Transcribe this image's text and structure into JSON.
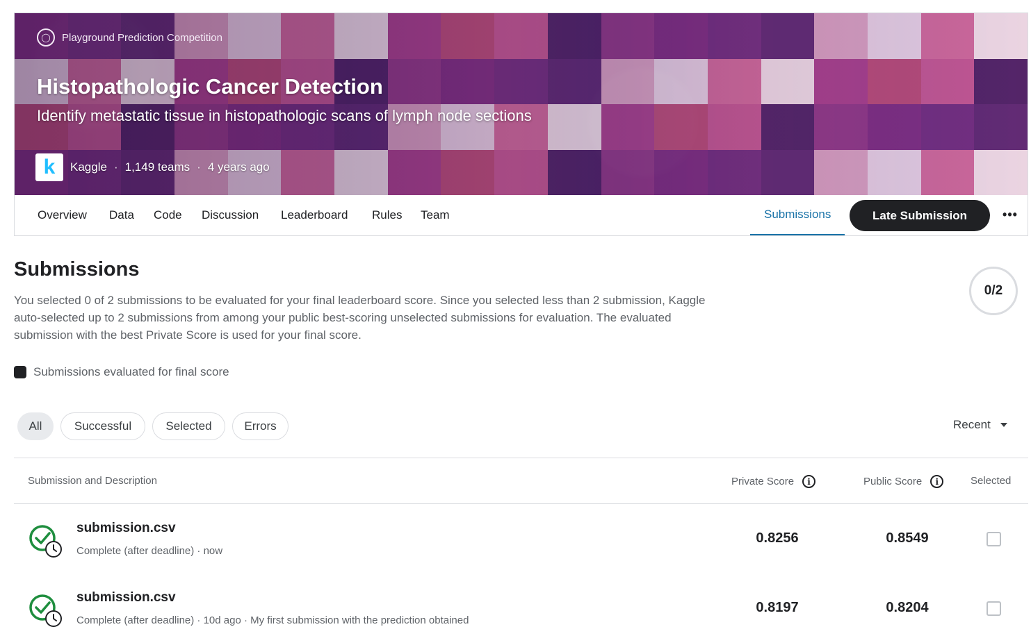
{
  "hero": {
    "competition_type": "Playground Prediction Competition",
    "title": "Histopathologic Cancer Detection",
    "subtitle": "Identify metastatic tissue in histopathologic scans of lymph node sections",
    "host": "Kaggle",
    "teams": "1,149 teams",
    "age": "4 years ago",
    "logo_letter": "k"
  },
  "tabs": [
    "Overview",
    "Data",
    "Code",
    "Discussion",
    "Leaderboard",
    "Rules",
    "Team"
  ],
  "active_tab": "Submissions",
  "late_submission_label": "Late Submission",
  "page": {
    "title": "Submissions",
    "description": "You selected 0 of 2 submissions to be evaluated for your final leaderboard score. Since you selected less than 2 submission, Kaggle auto-selected up to 2 submissions from among your public best-scoring unselected submissions for evaluation. The evaluated submission with the best Private Score is used for your final score.",
    "counter": "0/2",
    "legend": "Submissions evaluated for final score"
  },
  "filters": [
    "All",
    "Successful",
    "Selected",
    "Errors"
  ],
  "sort_label": "Recent",
  "table": {
    "col_submission": "Submission and Description",
    "col_private": "Private Score",
    "col_public": "Public Score",
    "col_selected": "Selected",
    "rows": [
      {
        "file": "submission.csv",
        "meta": "Complete (after deadline) · now",
        "private": "0.8256",
        "public": "0.8549"
      },
      {
        "file": "submission.csv",
        "meta": "Complete (after deadline) · 10d ago · My first submission with the prediction obtained",
        "private": "0.8197",
        "public": "0.8204"
      }
    ]
  },
  "colors": {
    "accent": "#1a73a8",
    "success": "#1e8e3e",
    "dark": "#202124"
  }
}
